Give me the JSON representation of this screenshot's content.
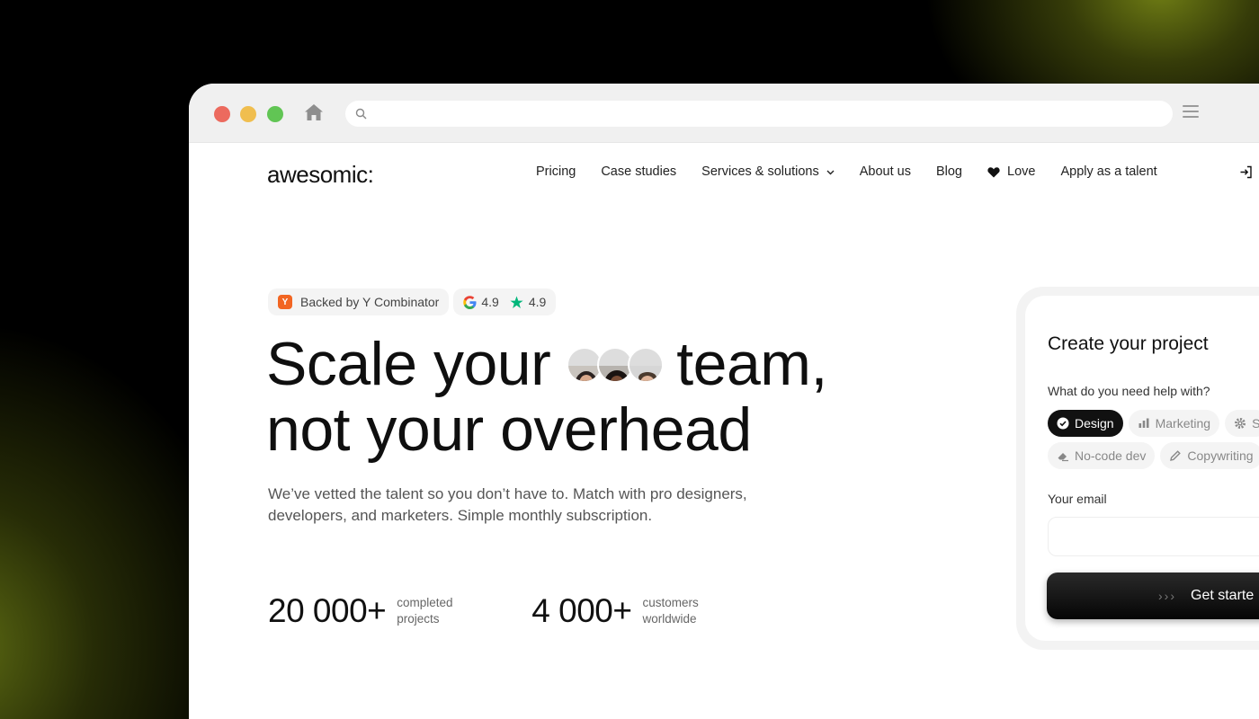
{
  "browser": {
    "url_placeholder": ""
  },
  "nav": {
    "logo": "awesomic:",
    "items": [
      {
        "label": "Pricing"
      },
      {
        "label": "Case studies"
      },
      {
        "label": "Services & solutions"
      },
      {
        "label": "About us"
      },
      {
        "label": "Blog"
      },
      {
        "label": "Love"
      },
      {
        "label": "Apply as a talent"
      }
    ]
  },
  "badges": {
    "yc_letter": "Y",
    "yc_label": "Backed by Y Combinator",
    "google_rating": "4.9",
    "trustpilot_rating": "4.9"
  },
  "hero": {
    "line1_a": "Scale your",
    "line1_b": "team,",
    "line2": "not your overhead",
    "subtitle": "We’ve vetted the talent so you don’t have to. Match with pro designers, developers, and marketers. Simple monthly subscription."
  },
  "stats": [
    {
      "value": "20 000+",
      "label": "completed projects"
    },
    {
      "value": "4 000+",
      "label": "customers worldwide"
    }
  ],
  "card": {
    "title": "Create your project",
    "question": "What do you need help with?",
    "chips": [
      {
        "label": "Design",
        "icon": "check-circle-icon"
      },
      {
        "label": "Marketing",
        "icon": "bar-chart-icon"
      },
      {
        "label": "S",
        "icon": "gear-icon"
      },
      {
        "label": "No-code dev",
        "icon": "eraser-icon"
      },
      {
        "label": "Copywriting",
        "icon": "pencil-icon"
      }
    ],
    "email_label": "Your email",
    "email_placeholder": "",
    "cta_arrows": "›››",
    "cta_label": "Get starte"
  },
  "colors": {
    "accent_dark": "#111111",
    "yc_orange": "#f26522",
    "trustpilot_green": "#00b67a",
    "traffic_red": "#ec6a5e",
    "traffic_yellow": "#f0be4f",
    "traffic_green": "#61c554"
  }
}
